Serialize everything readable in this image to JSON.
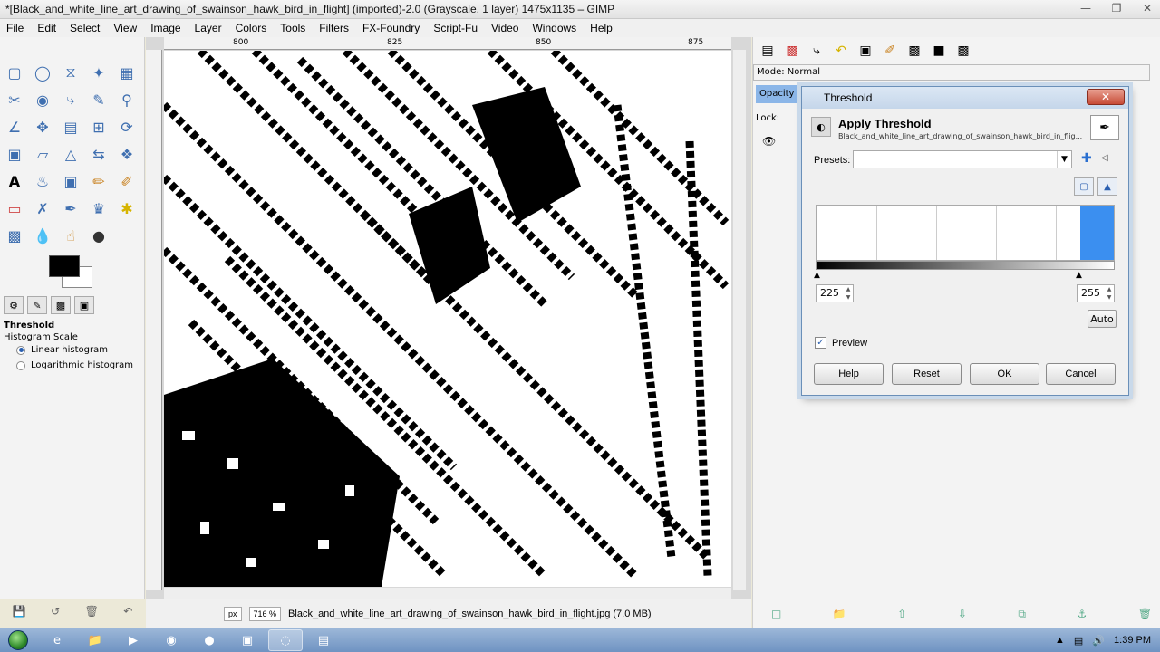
{
  "window": {
    "title": "*[Black_and_white_line_art_drawing_of_swainson_hawk_bird_in_flight] (imported)-2.0 (Grayscale, 1 layer) 1475x1135 – GIMP"
  },
  "menu": [
    "File",
    "Edit",
    "Select",
    "View",
    "Image",
    "Layer",
    "Colors",
    "Tools",
    "Filters",
    "FX-Foundry",
    "Script-Fu",
    "Video",
    "Windows",
    "Help"
  ],
  "ruler": {
    "ticks": [
      "800",
      "825",
      "850",
      "875"
    ]
  },
  "tool_options": {
    "title": "Threshold",
    "subtitle": "Histogram Scale",
    "options": [
      "Linear histogram",
      "Logarithmic histogram"
    ],
    "selected": "Linear histogram"
  },
  "status": {
    "unit": "px",
    "zoom": "716 %",
    "file": "Black_and_white_line_art_drawing_of_swainson_hawk_bird_in_flight.jpg (7.0 MB)"
  },
  "layers_dock": {
    "mode_label": "Mode: Normal",
    "opacity_label": "Opacity",
    "lock_label": "Lock:"
  },
  "dialog": {
    "title": "Threshold",
    "heading": "Apply Threshold",
    "subheading": "Black_and_white_line_art_drawing_of_swainson_hawk_bird_in_flig...",
    "presets_label": "Presets:",
    "presets_value": "",
    "low": "225",
    "high": "255",
    "low_fraction": 0.882,
    "auto_label": "Auto",
    "preview_label": "Preview",
    "preview_checked": true,
    "buttons": {
      "help": "Help",
      "reset": "Reset",
      "ok": "OK",
      "cancel": "Cancel"
    }
  },
  "clock": "1:39 PM",
  "colors": {
    "accent": "#3b8ff0",
    "fg": "#000000",
    "bg": "#ffffff"
  }
}
